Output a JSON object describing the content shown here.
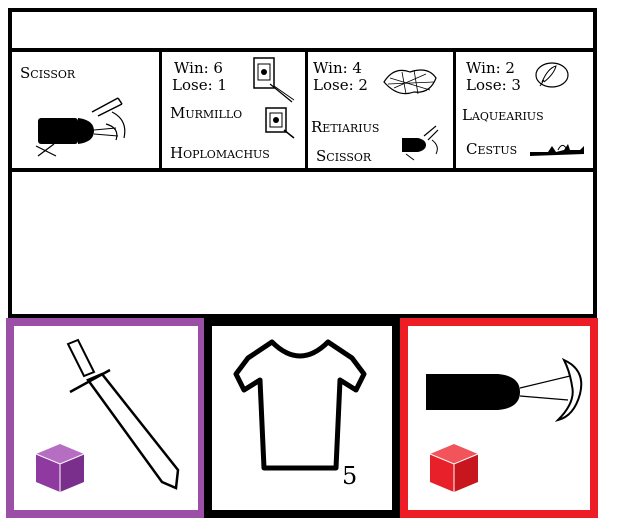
{
  "roster": {
    "fighter": {
      "name": "Scissor"
    },
    "opponents": [
      {
        "win": "Win: 6",
        "lose": "Lose: 1",
        "type_a": "Murmillo",
        "type_b": "Hoplomachus"
      },
      {
        "win": "Win: 4",
        "lose": "Lose: 2",
        "type_a": "Retiarius",
        "type_b": "Scissor"
      },
      {
        "win": "Win: 2",
        "lose": "Lose: 3",
        "type_a": "Laquearius",
        "type_b": "Cestus"
      }
    ]
  },
  "hand": {
    "left_card": {
      "icon": "sword-icon",
      "die": "purple-die-icon"
    },
    "middle_card": {
      "icon": "tunic-icon",
      "count": "5"
    },
    "right_card": {
      "icon": "scissor-blade-icon",
      "die": "red-die-icon"
    }
  },
  "colors": {
    "player_purple": "#9b4fa6",
    "opponent_red": "#ee1c24",
    "die_purple": "#8e3aa0",
    "die_red": "#e8202a"
  }
}
